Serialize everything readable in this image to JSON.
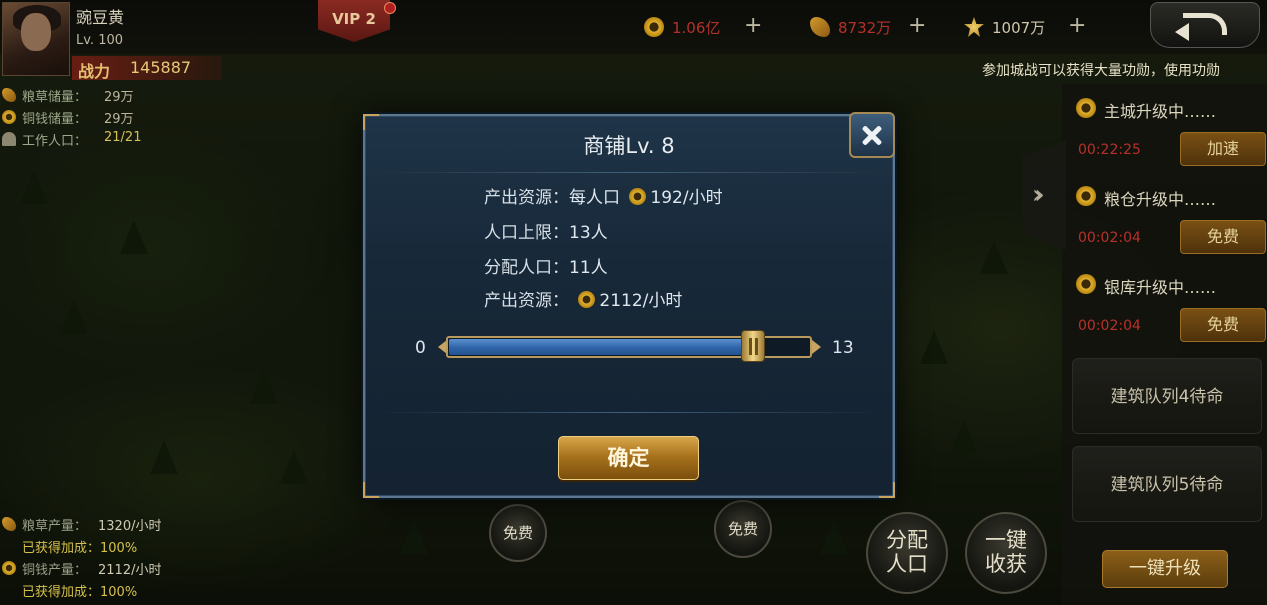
{
  "player": {
    "name": "豌豆黄",
    "level": "Lv. 100",
    "power_label": "战力",
    "power_value": "145887",
    "vip": "VIP 2"
  },
  "resources": [
    {
      "icon": "coin-icon",
      "value": "1.06亿"
    },
    {
      "icon": "grain-icon",
      "value": "8732万"
    },
    {
      "icon": "merit-icon",
      "value": "1007万"
    }
  ],
  "marquee": "参加城战可以获得大量功勋，使用功勋",
  "storage": [
    {
      "label": "粮草储量：",
      "value": "29万"
    },
    {
      "label": "铜钱储量：",
      "value": "29万"
    },
    {
      "label": "工作人口：",
      "value": "21/21"
    }
  ],
  "production": {
    "grain_label": "粮草产量：",
    "grain_value": "1320/小时",
    "grain_bonus": "已获得加成：100%",
    "copper_label": "铜钱产量：",
    "copper_value": "2112/小时",
    "copper_bonus": "已获得加成：100%"
  },
  "queue": [
    {
      "title": "主城升级中……",
      "time": "00:22:25",
      "button": "加速"
    },
    {
      "title": "粮仓升级中……",
      "time": "00:02:04",
      "button": "免费"
    },
    {
      "title": "银库升级中……",
      "time": "00:02:04",
      "button": "免费"
    }
  ],
  "idle_queues": [
    "建筑队列4待命",
    "建筑队列5待命"
  ],
  "upgrade_all": "一键升级",
  "bottom_buttons": {
    "free1": "免费",
    "free2": "免费",
    "assign_line1": "分配",
    "assign_line2": "人口",
    "harvest_line1": "一键",
    "harvest_line2": "收获"
  },
  "modal": {
    "title": "商铺Lv. 8",
    "rows": [
      {
        "label": "产出资源：",
        "text": "每人口",
        "value": "192/小时"
      },
      {
        "label": "人口上限：",
        "value": "13人"
      },
      {
        "label": "分配人口：",
        "value": "11人"
      },
      {
        "label": "产出资源：",
        "value": "2112/小时"
      }
    ],
    "slider": {
      "min": "0",
      "max": "13",
      "value": 11
    },
    "confirm": "确定"
  },
  "colors": {
    "accent_gold": "#c8a460",
    "slider_blue": "#2f64a8",
    "timer_red": "#b9302a"
  }
}
